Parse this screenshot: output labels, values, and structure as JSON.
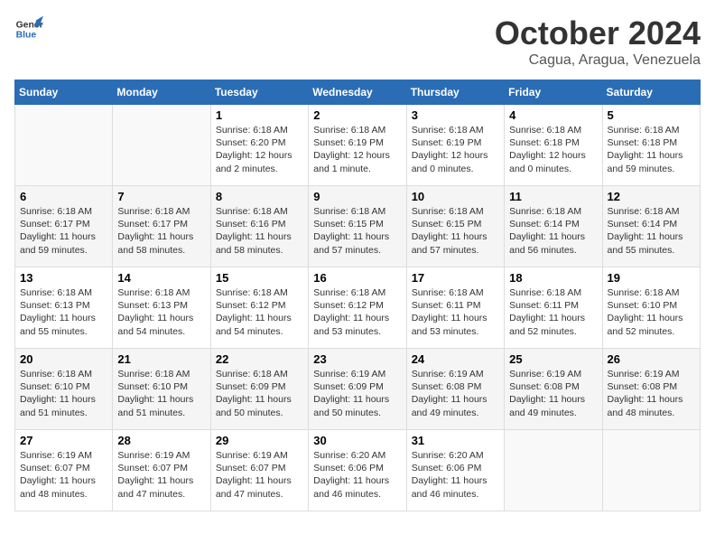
{
  "logo": {
    "general": "General",
    "blue": "Blue",
    "icon_title": "GeneralBlue logo"
  },
  "title": {
    "month_year": "October 2024",
    "location": "Cagua, Aragua, Venezuela"
  },
  "headers": [
    "Sunday",
    "Monday",
    "Tuesday",
    "Wednesday",
    "Thursday",
    "Friday",
    "Saturday"
  ],
  "weeks": [
    [
      {
        "day": "",
        "sunrise": "",
        "sunset": "",
        "daylight": ""
      },
      {
        "day": "",
        "sunrise": "",
        "sunset": "",
        "daylight": ""
      },
      {
        "day": "1",
        "sunrise": "Sunrise: 6:18 AM",
        "sunset": "Sunset: 6:20 PM",
        "daylight": "Daylight: 12 hours and 2 minutes."
      },
      {
        "day": "2",
        "sunrise": "Sunrise: 6:18 AM",
        "sunset": "Sunset: 6:19 PM",
        "daylight": "Daylight: 12 hours and 1 minute."
      },
      {
        "day": "3",
        "sunrise": "Sunrise: 6:18 AM",
        "sunset": "Sunset: 6:19 PM",
        "daylight": "Daylight: 12 hours and 0 minutes."
      },
      {
        "day": "4",
        "sunrise": "Sunrise: 6:18 AM",
        "sunset": "Sunset: 6:18 PM",
        "daylight": "Daylight: 12 hours and 0 minutes."
      },
      {
        "day": "5",
        "sunrise": "Sunrise: 6:18 AM",
        "sunset": "Sunset: 6:18 PM",
        "daylight": "Daylight: 11 hours and 59 minutes."
      }
    ],
    [
      {
        "day": "6",
        "sunrise": "Sunrise: 6:18 AM",
        "sunset": "Sunset: 6:17 PM",
        "daylight": "Daylight: 11 hours and 59 minutes."
      },
      {
        "day": "7",
        "sunrise": "Sunrise: 6:18 AM",
        "sunset": "Sunset: 6:17 PM",
        "daylight": "Daylight: 11 hours and 58 minutes."
      },
      {
        "day": "8",
        "sunrise": "Sunrise: 6:18 AM",
        "sunset": "Sunset: 6:16 PM",
        "daylight": "Daylight: 11 hours and 58 minutes."
      },
      {
        "day": "9",
        "sunrise": "Sunrise: 6:18 AM",
        "sunset": "Sunset: 6:15 PM",
        "daylight": "Daylight: 11 hours and 57 minutes."
      },
      {
        "day": "10",
        "sunrise": "Sunrise: 6:18 AM",
        "sunset": "Sunset: 6:15 PM",
        "daylight": "Daylight: 11 hours and 57 minutes."
      },
      {
        "day": "11",
        "sunrise": "Sunrise: 6:18 AM",
        "sunset": "Sunset: 6:14 PM",
        "daylight": "Daylight: 11 hours and 56 minutes."
      },
      {
        "day": "12",
        "sunrise": "Sunrise: 6:18 AM",
        "sunset": "Sunset: 6:14 PM",
        "daylight": "Daylight: 11 hours and 55 minutes."
      }
    ],
    [
      {
        "day": "13",
        "sunrise": "Sunrise: 6:18 AM",
        "sunset": "Sunset: 6:13 PM",
        "daylight": "Daylight: 11 hours and 55 minutes."
      },
      {
        "day": "14",
        "sunrise": "Sunrise: 6:18 AM",
        "sunset": "Sunset: 6:13 PM",
        "daylight": "Daylight: 11 hours and 54 minutes."
      },
      {
        "day": "15",
        "sunrise": "Sunrise: 6:18 AM",
        "sunset": "Sunset: 6:12 PM",
        "daylight": "Daylight: 11 hours and 54 minutes."
      },
      {
        "day": "16",
        "sunrise": "Sunrise: 6:18 AM",
        "sunset": "Sunset: 6:12 PM",
        "daylight": "Daylight: 11 hours and 53 minutes."
      },
      {
        "day": "17",
        "sunrise": "Sunrise: 6:18 AM",
        "sunset": "Sunset: 6:11 PM",
        "daylight": "Daylight: 11 hours and 53 minutes."
      },
      {
        "day": "18",
        "sunrise": "Sunrise: 6:18 AM",
        "sunset": "Sunset: 6:11 PM",
        "daylight": "Daylight: 11 hours and 52 minutes."
      },
      {
        "day": "19",
        "sunrise": "Sunrise: 6:18 AM",
        "sunset": "Sunset: 6:10 PM",
        "daylight": "Daylight: 11 hours and 52 minutes."
      }
    ],
    [
      {
        "day": "20",
        "sunrise": "Sunrise: 6:18 AM",
        "sunset": "Sunset: 6:10 PM",
        "daylight": "Daylight: 11 hours and 51 minutes."
      },
      {
        "day": "21",
        "sunrise": "Sunrise: 6:18 AM",
        "sunset": "Sunset: 6:10 PM",
        "daylight": "Daylight: 11 hours and 51 minutes."
      },
      {
        "day": "22",
        "sunrise": "Sunrise: 6:18 AM",
        "sunset": "Sunset: 6:09 PM",
        "daylight": "Daylight: 11 hours and 50 minutes."
      },
      {
        "day": "23",
        "sunrise": "Sunrise: 6:19 AM",
        "sunset": "Sunset: 6:09 PM",
        "daylight": "Daylight: 11 hours and 50 minutes."
      },
      {
        "day": "24",
        "sunrise": "Sunrise: 6:19 AM",
        "sunset": "Sunset: 6:08 PM",
        "daylight": "Daylight: 11 hours and 49 minutes."
      },
      {
        "day": "25",
        "sunrise": "Sunrise: 6:19 AM",
        "sunset": "Sunset: 6:08 PM",
        "daylight": "Daylight: 11 hours and 49 minutes."
      },
      {
        "day": "26",
        "sunrise": "Sunrise: 6:19 AM",
        "sunset": "Sunset: 6:08 PM",
        "daylight": "Daylight: 11 hours and 48 minutes."
      }
    ],
    [
      {
        "day": "27",
        "sunrise": "Sunrise: 6:19 AM",
        "sunset": "Sunset: 6:07 PM",
        "daylight": "Daylight: 11 hours and 48 minutes."
      },
      {
        "day": "28",
        "sunrise": "Sunrise: 6:19 AM",
        "sunset": "Sunset: 6:07 PM",
        "daylight": "Daylight: 11 hours and 47 minutes."
      },
      {
        "day": "29",
        "sunrise": "Sunrise: 6:19 AM",
        "sunset": "Sunset: 6:07 PM",
        "daylight": "Daylight: 11 hours and 47 minutes."
      },
      {
        "day": "30",
        "sunrise": "Sunrise: 6:20 AM",
        "sunset": "Sunset: 6:06 PM",
        "daylight": "Daylight: 11 hours and 46 minutes."
      },
      {
        "day": "31",
        "sunrise": "Sunrise: 6:20 AM",
        "sunset": "Sunset: 6:06 PM",
        "daylight": "Daylight: 11 hours and 46 minutes."
      },
      {
        "day": "",
        "sunrise": "",
        "sunset": "",
        "daylight": ""
      },
      {
        "day": "",
        "sunrise": "",
        "sunset": "",
        "daylight": ""
      }
    ]
  ]
}
